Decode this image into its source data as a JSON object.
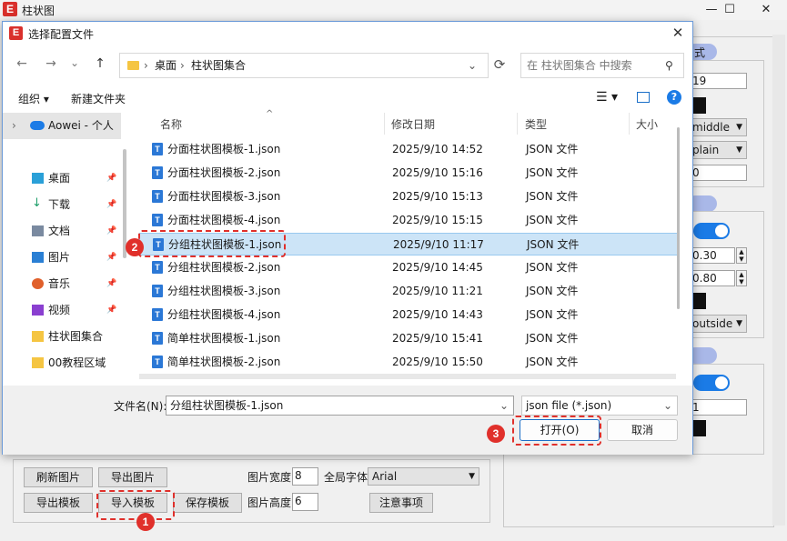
{
  "app": {
    "title": "柱状图",
    "logo": "E",
    "controls": [
      "—",
      "☐",
      "✕"
    ],
    "right_panel": {
      "header1": "式",
      "value_19": "19",
      "valign": "middle",
      "style": "plain",
      "value_0": "0",
      "spin1": "0.30",
      "spin2": "0.80",
      "legend_pos": "outside",
      "value_1": "1"
    },
    "bottom": {
      "refresh_btn": "刷新图片",
      "export_img_btn": "导出图片",
      "export_tpl_btn": "导出模板",
      "import_tpl_btn": "导入模板",
      "save_tpl_btn": "保存模板",
      "width_label": "图片宽度",
      "width_value": "8",
      "height_label": "图片高度",
      "height_value": "6",
      "font_label": "全局字体",
      "font_value": "Arial",
      "notes_btn": "注意事项"
    }
  },
  "dialog": {
    "title": "选择配置文件",
    "logo": "E",
    "close": "✕",
    "nav": {
      "back": "←",
      "forward": "→",
      "recent": "⌄",
      "up": "↑"
    },
    "breadcrumb": [
      "桌面",
      "柱状图集合"
    ],
    "refresh": "⟳",
    "search_placeholder": "在 柱状图集合 中搜索",
    "toolbar": {
      "organize": "组织 ▾",
      "new_folder": "新建文件夹"
    },
    "sidebar": {
      "root": "Aowei - 个人",
      "items": [
        {
          "label": "桌面",
          "icon": "desktop-icon",
          "pinned": true
        },
        {
          "label": "下载",
          "icon": "download-icon",
          "pinned": true
        },
        {
          "label": "文档",
          "icon": "document-icon",
          "pinned": true
        },
        {
          "label": "图片",
          "icon": "picture-icon",
          "pinned": true
        },
        {
          "label": "音乐",
          "icon": "music-icon",
          "pinned": true
        },
        {
          "label": "视频",
          "icon": "video-icon",
          "pinned": true
        },
        {
          "label": "柱状图集合",
          "icon": "folder-icon",
          "pinned": false
        },
        {
          "label": "00教程区域",
          "icon": "folder-icon",
          "pinned": false
        }
      ]
    },
    "columns": {
      "name": "名称",
      "date": "修改日期",
      "type": "类型",
      "size": "大小"
    },
    "files": [
      {
        "name": "分面柱状图模板-1.json",
        "date": "2025/9/10 14:52",
        "type": "JSON 文件",
        "selected": false
      },
      {
        "name": "分面柱状图模板-2.json",
        "date": "2025/9/10 15:16",
        "type": "JSON 文件",
        "selected": false
      },
      {
        "name": "分面柱状图模板-3.json",
        "date": "2025/9/10 15:13",
        "type": "JSON 文件",
        "selected": false
      },
      {
        "name": "分面柱状图模板-4.json",
        "date": "2025/9/10 15:15",
        "type": "JSON 文件",
        "selected": false
      },
      {
        "name": "分组柱状图模板-1.json",
        "date": "2025/9/10 11:17",
        "type": "JSON 文件",
        "selected": true
      },
      {
        "name": "分组柱状图模板-2.json",
        "date": "2025/9/10 14:45",
        "type": "JSON 文件",
        "selected": false
      },
      {
        "name": "分组柱状图模板-3.json",
        "date": "2025/9/10 11:21",
        "type": "JSON 文件",
        "selected": false
      },
      {
        "name": "分组柱状图模板-4.json",
        "date": "2025/9/10 14:43",
        "type": "JSON 文件",
        "selected": false
      },
      {
        "name": "简单柱状图模板-1.json",
        "date": "2025/9/10 15:41",
        "type": "JSON 文件",
        "selected": false
      },
      {
        "name": "简单柱状图模板-2.json",
        "date": "2025/9/10 15:50",
        "type": "JSON 文件",
        "selected": false
      }
    ],
    "filename_label": "文件名(N):",
    "filename_value": "分组柱状图模板-1.json",
    "filter": "json file (*.json)",
    "open_btn": "打开(O)",
    "cancel_btn": "取消"
  },
  "annotations": {
    "step1": "1",
    "step2": "2",
    "step3": "3"
  },
  "colors": {
    "accent": "#1b7be6",
    "selection": "#cce4f7",
    "annotation_red": "#e0302b",
    "header_pill": "#a9b8e8"
  }
}
